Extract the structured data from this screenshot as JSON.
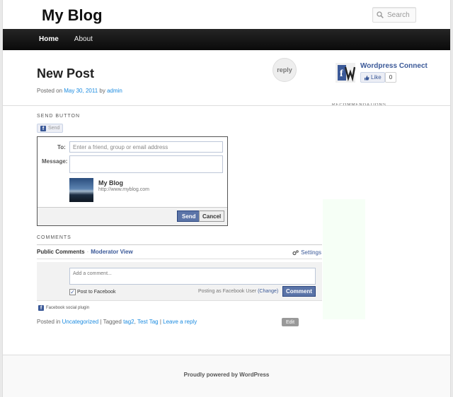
{
  "site": {
    "title": "My Blog",
    "search_placeholder": "Search"
  },
  "nav": {
    "items": [
      {
        "label": "Home",
        "active": true
      },
      {
        "label": "About",
        "active": false
      }
    ]
  },
  "post": {
    "title": "New Post",
    "meta": {
      "prefix": "Posted on",
      "date": "May 30, 2011",
      "by": "by",
      "author": "admin"
    },
    "reply_bubble": "reply"
  },
  "widget": {
    "title": "Wordpress Connect",
    "like_label": "Like",
    "like_count": "0",
    "recommendations_heading": "RECOMMENDATIONS"
  },
  "send_section": {
    "label": "SEND BUTTON",
    "button_label": "Send",
    "dialog": {
      "to_label": "To:",
      "to_placeholder": "Enter a friend, group or email address",
      "message_label": "Message:",
      "preview_title": "My Blog",
      "preview_url": "http://www.myblog.com",
      "send_label": "Send",
      "cancel_label": "Cancel"
    }
  },
  "comments": {
    "label": "COMMENTS",
    "tabs": {
      "public": "Public Comments",
      "separator": "·",
      "moderator": "Moderator View"
    },
    "settings_label": "Settings",
    "input_placeholder": "Add a comment...",
    "post_to_facebook": "Post to Facebook",
    "post_to_facebook_checked": true,
    "posting_as": "Posting as Facebook User",
    "change_label": "(Change)",
    "comment_button": "Comment",
    "plugin_label": "Facebook social plugin"
  },
  "post_footer": {
    "posted_in": "Posted in",
    "category": "Uncategorized",
    "pipe": "|",
    "tagged": "Tagged",
    "tags": [
      "tag2",
      "Test Tag"
    ],
    "tag_sep": ",",
    "leave_reply": "Leave a reply",
    "edit_label": "Edit"
  },
  "site_footer": {
    "credit": "Proudly powered by WordPress"
  },
  "colors": {
    "link": "#1b8be0",
    "facebook_blue": "#3b5998",
    "nav_bg": "#111111"
  }
}
